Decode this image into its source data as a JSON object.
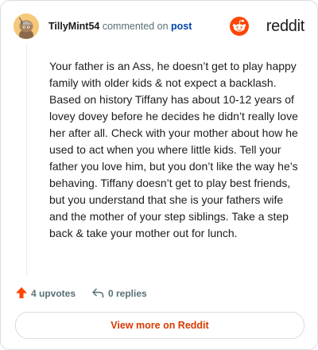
{
  "header": {
    "username": "TillyMint54",
    "action_text": "commented on",
    "post_link": "post"
  },
  "brand": {
    "wordmark": "reddit",
    "logo_icon": "reddit-snoo-icon",
    "color": "#ff4500"
  },
  "comment": {
    "body": "Your father is an Ass, he doesn’t get to play happy family with older kids & not expect a backlash. Based on history Tiffany has about 10-12 years of lovey dovey before he decides he didn’t really love her after all. Check with your mother about how he used to act when you where little kids. Tell your father you love him, but you don’t like the way he’s behaving. Tiffany doesn’t get to play best friends, but you understand that she is your fathers wife and the mother of your step siblings. Take a step back & take your mother out for lunch."
  },
  "actions": {
    "upvotes_label": "4 upvotes",
    "upvote_icon": "upvote-arrow-icon",
    "upvote_color": "#ff4500",
    "replies_label": "0 replies",
    "reply_icon": "reply-arrow-icon"
  },
  "footer": {
    "view_more_label": "View more on Reddit",
    "accent_color": "#d93a00"
  }
}
